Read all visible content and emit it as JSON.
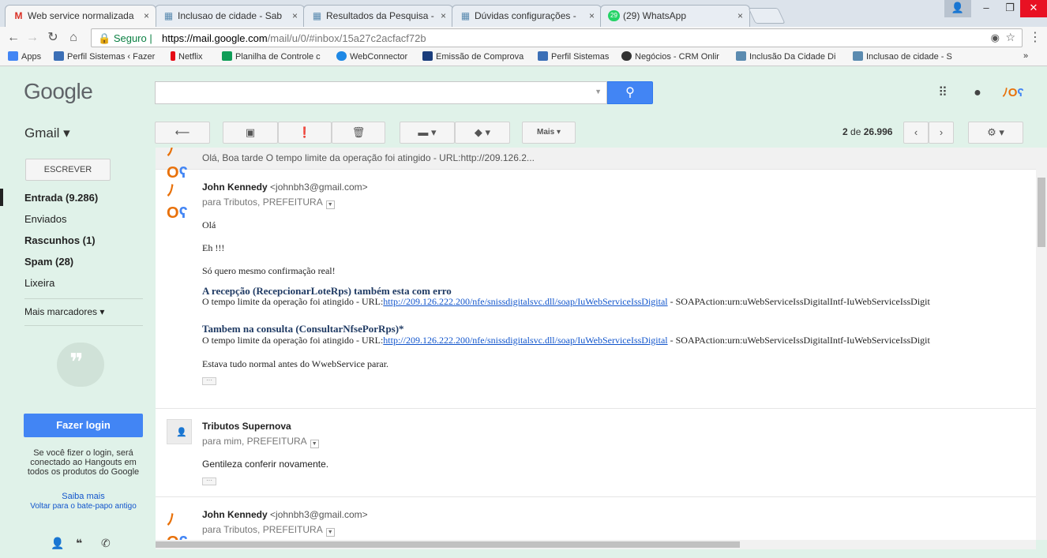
{
  "tabs": [
    {
      "label": "Web service normalizada",
      "favicon": "gmail-icon",
      "active": true
    },
    {
      "label": "Inclusao de cidade - Sab",
      "favicon": "page-icon"
    },
    {
      "label": "Resultados da Pesquisa -",
      "favicon": "page-icon"
    },
    {
      "label": "Dúvidas configurações -",
      "favicon": "page-icon"
    },
    {
      "label": "(29) WhatsApp",
      "favicon": "whatsapp-icon"
    }
  ],
  "tab_close": "×",
  "omnibox": {
    "secure_label": "Seguro",
    "url_scheme_domain": "https://mail.google.com",
    "url_path": "/mail/u/0/#inbox/15a27c2acfacf72b"
  },
  "bookmarks": [
    {
      "label": "Apps",
      "color": "#4285f4"
    },
    {
      "label": "Perfil Sistemas ‹ Fazer",
      "color": "#3b6fb6"
    },
    {
      "label": "Netflix",
      "color": "#e50914"
    },
    {
      "label": "Planilha de Controle c",
      "color": "#0f9d58"
    },
    {
      "label": "WebConnector",
      "color": "#1e88e5"
    },
    {
      "label": "Emissão de Comprova",
      "color": "#1a3d7c"
    },
    {
      "label": "Perfil Sistemas",
      "color": "#3b6fb6"
    },
    {
      "label": "Negócios - CRM Onlir",
      "color": "#333333"
    },
    {
      "label": "Inclusão Da Cidade Di",
      "color": "#5b8bb0"
    },
    {
      "label": "Inclusao de cidade - S",
      "color": "#5b8bb0"
    }
  ],
  "bookmarks_more": "»",
  "header": {
    "logo": "Google",
    "search_placeholder": "",
    "gmail_label": "Gmail ▾"
  },
  "toolbar": {
    "more_label": "Mais ▾",
    "count_current": "2",
    "count_of": "de",
    "count_total": "26.996"
  },
  "sidebar": {
    "compose_label": "ESCREVER",
    "items": [
      {
        "label": "Entrada (9.286)",
        "bold": true
      },
      {
        "label": "Enviados",
        "bold": false
      },
      {
        "label": "Rascunhos (1)",
        "bold": true
      },
      {
        "label": "Spam (28)",
        "bold": true
      },
      {
        "label": "Lixeira",
        "bold": false
      }
    ],
    "more_labels": "Mais marcadores ▾",
    "login_button": "Fazer login",
    "hangouts_text": "Se você fizer o login, será conectado ao Hangouts em todos os produtos do Google",
    "learn_more": "Saiba mais",
    "old_chat": "Voltar para o bate-papo antigo"
  },
  "thread": {
    "collapsed_snippet": "Olá, Boa tarde O tempo limite da operação foi atingido - URL:http://209.126.2...",
    "messages": [
      {
        "sender": "John Kennedy",
        "email": "<johnbh3@gmail.com>",
        "recipients": "para Tributos, PREFEITURA",
        "lines": {
          "l1": "Olá",
          "l2": "Eh !!!",
          "l3": "Só quero mesmo confirmação real!",
          "h1": "A recepção (RecepcionarLoteRps) também esta com erro",
          "err1_pre": "O tempo limite da operação foi atingido - URL:",
          "err1_link": "http://209.126.222.200/nfe/snissdigitalsvc.dll/soap/IuWebServiceIssDigital",
          "err1_post": " - SOAPAction:urn:uWebServiceIssDigitalIntf-IuWebServiceIssDigit",
          "h2": "Tambem na consulta (ConsultarNfsePorRps)*",
          "err2_pre": "O tempo limite da operação foi atingido - URL:",
          "err2_link": "http://209.126.222.200/nfe/snissdigitalsvc.dll/soap/IuWebServiceIssDigital",
          "err2_post": " - SOAPAction:urn:uWebServiceIssDigitalIntf-IuWebServiceIssDigit",
          "l4": "Estava tudo normal antes do WwebService parar."
        }
      },
      {
        "sender": "Tributos Supernova",
        "recipients": "para mim, PREFEITURA",
        "body": "Gentileza conferir novamente."
      },
      {
        "sender": "John Kennedy",
        "email": "<johnbh3@gmail.com>",
        "recipients": "para Tributos, PREFEITURA"
      }
    ]
  }
}
